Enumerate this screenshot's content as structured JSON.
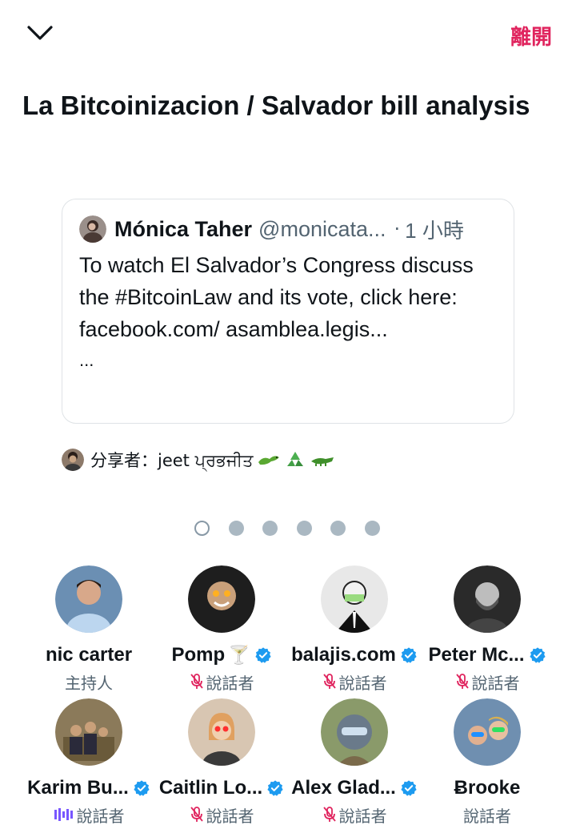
{
  "header": {
    "collapse_icon": "chevron-down-icon",
    "leave_label": "離開",
    "accent": "#e0245e"
  },
  "space": {
    "title": "La Bitcoinizacion / Salvador bill analysis"
  },
  "pinned_tweet": {
    "name": "Mónica Taher",
    "handle": "@monicata...",
    "separator": "·",
    "time": "1 小時",
    "text": "To watch El Salvador’s Congress discuss the #BitcoinLaw and its vote, click here: facebook.com/ asamblea.legis...",
    "more": "..."
  },
  "shared_by": {
    "text": "分享者：jeet ਪ੍ਰਭਜੀਤ",
    "emojis": [
      "lizard-emoji",
      "recycle-emoji",
      "crocodile-emoji"
    ]
  },
  "pager": {
    "pages": 6,
    "active": 0
  },
  "participants": [
    {
      "name": "nic carter",
      "role": "主持人",
      "verified": false,
      "role_icon": "",
      "color": "#6b8fb3"
    },
    {
      "name": "Pomp",
      "name_suffix": "🍸",
      "role": "說話者",
      "verified": true,
      "role_icon": "mic-muted-icon",
      "color": "#c9a07a"
    },
    {
      "name": "balajis.com",
      "role": "說話者",
      "verified": true,
      "role_icon": "mic-muted-icon",
      "color": "#e8e8e8"
    },
    {
      "name": "Peter Mc...",
      "role": "說話者",
      "verified": true,
      "role_icon": "mic-muted-icon",
      "color": "#2a2a2a"
    },
    {
      "name": "Karim Bu...",
      "role": "說話者",
      "verified": true,
      "role_icon": "speaking-icon",
      "color": "#8b7a5a"
    },
    {
      "name": "Caitlin Lo...",
      "role": "說話者",
      "verified": true,
      "role_icon": "mic-muted-icon",
      "color": "#d8c6b2"
    },
    {
      "name": "Alex Glad...",
      "role": "說話者",
      "verified": true,
      "role_icon": "mic-muted-icon",
      "color": "#8a9a6a"
    },
    {
      "name": "Ƀrooke",
      "role": "說話者",
      "verified": false,
      "role_icon": "",
      "color": "#6f8fb0"
    }
  ],
  "colors": {
    "verified_blue": "#1d9bf0",
    "mute_red": "#e0245e",
    "speaking_purple": "#7856ff",
    "secondary_text": "#536471"
  }
}
